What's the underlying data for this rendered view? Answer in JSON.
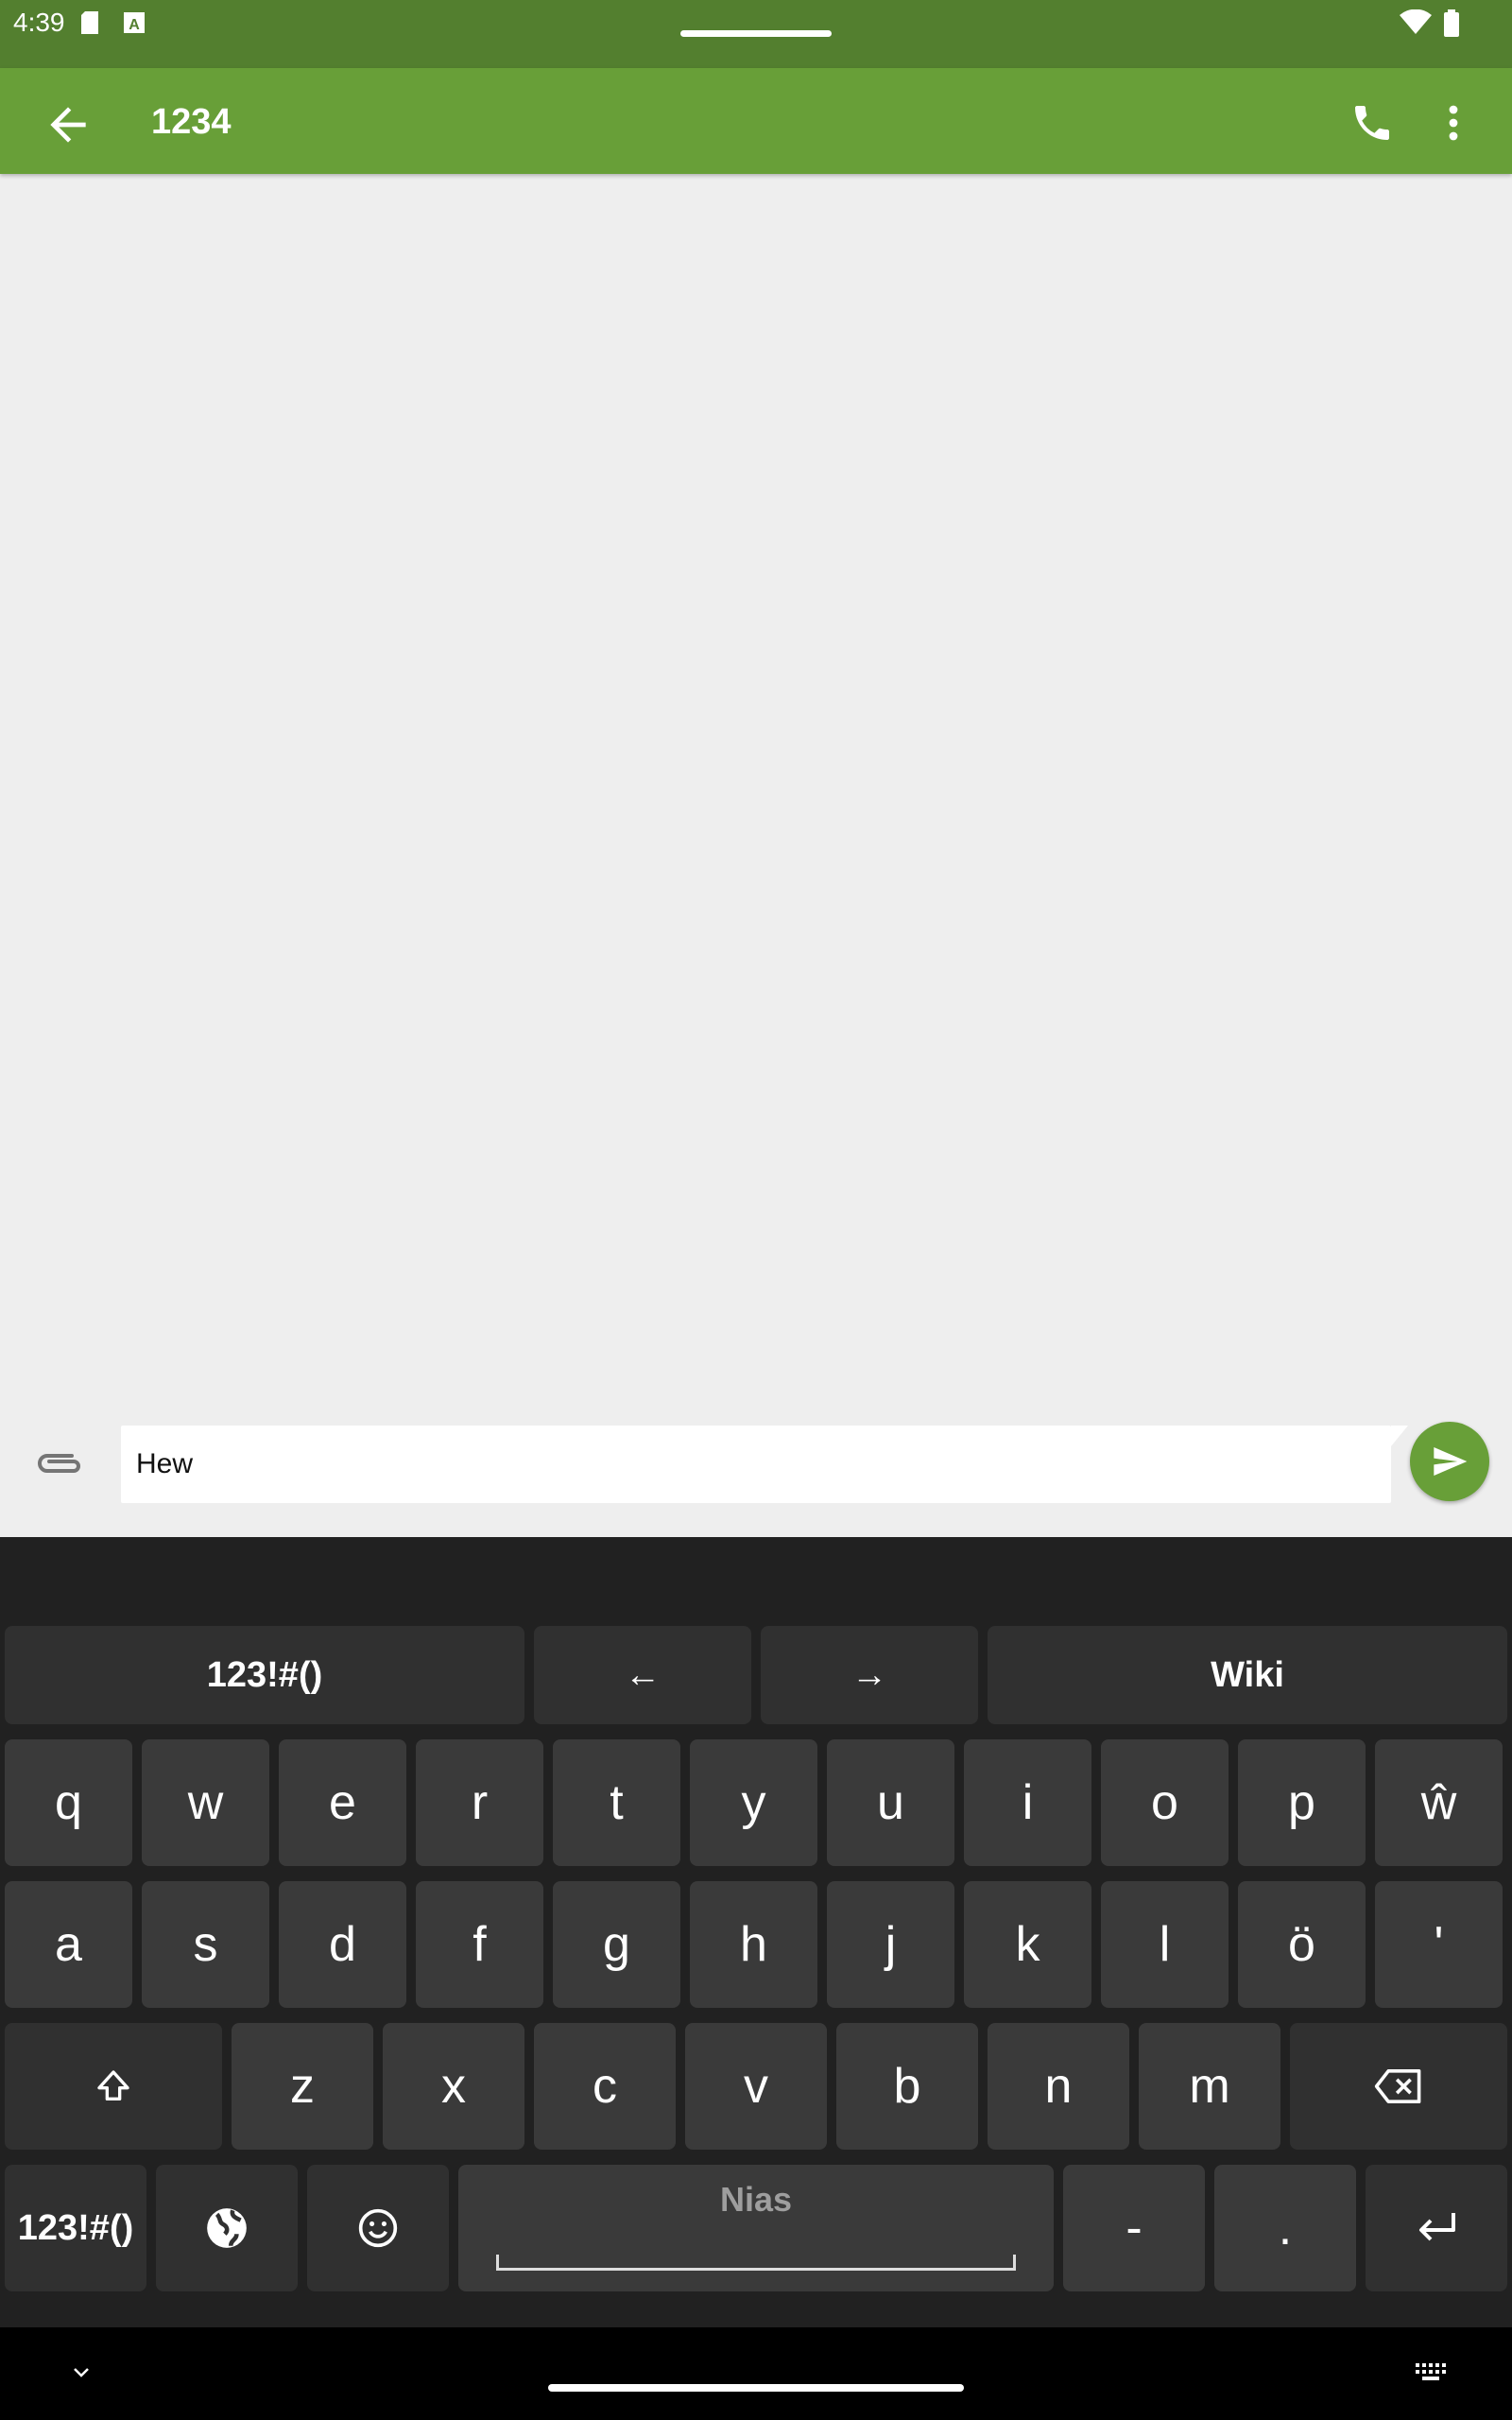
{
  "status_bar": {
    "time": "4:39",
    "icons": [
      "sd-card-icon",
      "text-a-icon",
      "wifi-icon",
      "battery-icon"
    ]
  },
  "app_bar": {
    "title": "1234",
    "color": "#689f38",
    "icons": [
      "back-arrow-icon",
      "phone-icon",
      "more-vert-icon"
    ]
  },
  "compose": {
    "text": "Hew",
    "icons": [
      "attach-icon",
      "send-icon"
    ]
  },
  "keyboard": {
    "top_row": [
      "123!#()",
      "←",
      "→",
      "Wiki"
    ],
    "row1": [
      "q",
      "w",
      "e",
      "r",
      "t",
      "y",
      "u",
      "i",
      "o",
      "p",
      "ŵ"
    ],
    "row2": [
      "a",
      "s",
      "d",
      "f",
      "g",
      "h",
      "j",
      "k",
      "l",
      "ö",
      "'"
    ],
    "row3": [
      "z",
      "x",
      "c",
      "v",
      "b",
      "n",
      "m"
    ],
    "bottom": {
      "symbols": "123!#()",
      "space_label": "Nias",
      "dash": "-",
      "period": "."
    }
  },
  "nav_bar": {
    "icons": [
      "chevron-down-icon",
      "keyboard-icon"
    ]
  }
}
